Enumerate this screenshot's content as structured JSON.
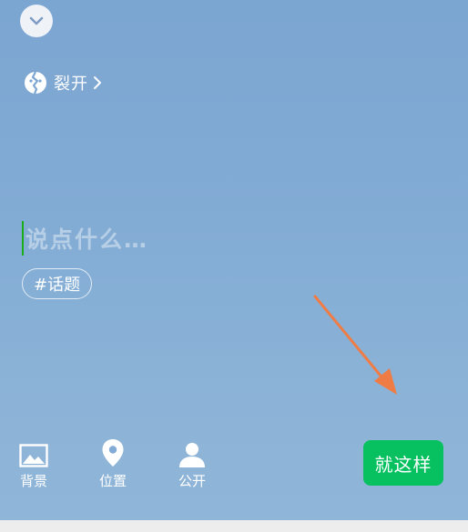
{
  "status": {
    "label": "裂开",
    "icon": "cracked-face-icon"
  },
  "composer": {
    "placeholder": "说点什么…"
  },
  "topic": {
    "label": "#话题"
  },
  "toolbar": {
    "items": [
      {
        "label": "背景",
        "icon": "image-icon"
      },
      {
        "label": "位置",
        "icon": "location-pin-icon"
      },
      {
        "label": "公开",
        "icon": "person-icon"
      }
    ]
  },
  "submit": {
    "label": "就这样"
  },
  "colors": {
    "accent_green": "#07c160",
    "caret_green": "#1aad19",
    "annotation_arrow": "#f07c45",
    "background_blue": "#82abd5"
  }
}
